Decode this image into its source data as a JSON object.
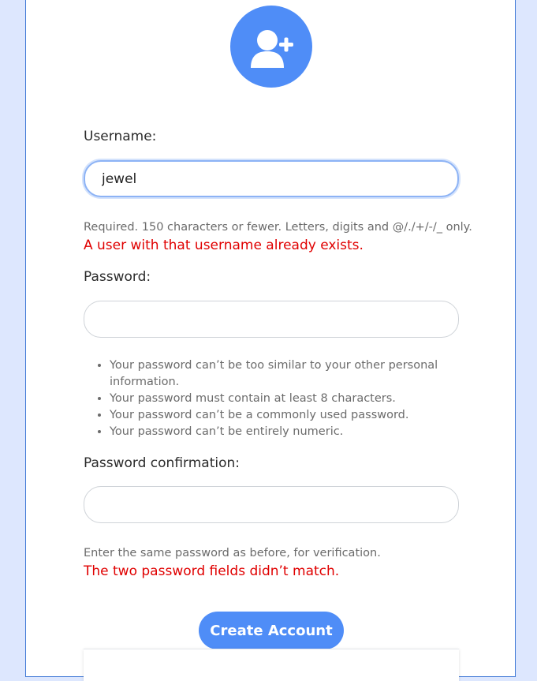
{
  "form": {
    "icon": "add-user-icon",
    "accent_color": "#4f8df7",
    "error_color": "#e00000",
    "username": {
      "label": "Username:",
      "value": "jewel",
      "help": "Required. 150 characters or fewer. Letters, digits and @/./+/-/_ only.",
      "error": "A user with that username already exists."
    },
    "password": {
      "label": "Password:",
      "value": "",
      "rules": [
        "Your password can’t be too similar to your other personal information.",
        "Your password must contain at least 8 characters.",
        "Your password can’t be a commonly used password.",
        "Your password can’t be entirely numeric."
      ]
    },
    "password_confirmation": {
      "label": "Password confirmation:",
      "value": "",
      "help": "Enter the same password as before, for verification.",
      "error": "The two password fields didn’t match."
    },
    "submit_label": "Create Account"
  }
}
